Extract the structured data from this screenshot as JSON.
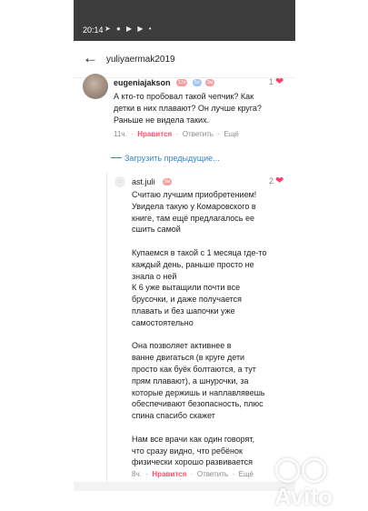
{
  "status_bar": {
    "time": "20:14",
    "icons": [
      "telegram-icon",
      "whatsapp-icon",
      "youtube-icon",
      "youtube-icon",
      "more-dots-icon"
    ]
  },
  "header": {
    "title": "yuliyaermak2019"
  },
  "comment1": {
    "username": "eugeniajakson",
    "badges": [
      {
        "label": "17л",
        "color": "#f4a0a0"
      },
      {
        "label": "5л",
        "color": "#a0c4f4"
      },
      {
        "label": "3м",
        "color": "#f4a0a0"
      }
    ],
    "likes": "1",
    "lines": [
      "А кто-то пробовал такой чепчик? Как",
      "детки в них плавают? Он лучше круга?",
      "Раньше не видела таких."
    ],
    "time": "11ч.",
    "like_label": "Нравится",
    "reply_label": "Ответить",
    "more_label": "Ещё"
  },
  "load_previous": "Загрузить предыдущие...",
  "comment2": {
    "username": "ast.juli",
    "badge": {
      "label": "9м",
      "color": "#f4a0a0"
    },
    "likes": "2",
    "lines": [
      "Считаю лучшим приобретением!",
      "Увидела такую у Комаровского в",
      "книге, там ещё предлагалось ее",
      "сшить самой",
      "",
      "Купаемся в такой с 1 месяца где-то",
      "каждый день, раньше просто не",
      "знала о ней",
      "К 6 уже вытащили почти все",
      "брусочки, и даже получается",
      "плавать и без шапочки уже",
      "самостоятельно",
      "",
      "Она позволяет активнее в",
      "ванне двигаться (в круге дети",
      "просто как буёк болтаются, а тут",
      "прям плавают), а шнурочки, за",
      "которые держишь и наплавлявешь",
      "обеспечивают безопасность, плюс",
      "спина спасибо скажет",
      "",
      "Нам все врачи как один говорят,",
      "что сразу видно, что ребёнок",
      "физически хорошо развивается"
    ],
    "time": "8ч.",
    "like_label": "Нравится",
    "reply_label": "Ответить",
    "more_label": "Ещё"
  },
  "watermark": "Avito"
}
